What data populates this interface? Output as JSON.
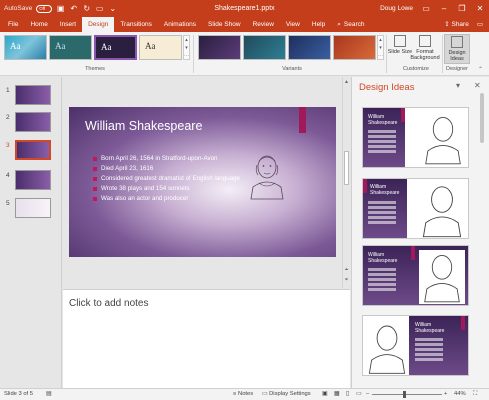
{
  "titlebar": {
    "autosave_label": "AutoSave",
    "autosave_state": "Off",
    "doc_title": "Shakespeare1.pptx",
    "user": "Doug Lowe",
    "qa_icons": [
      "save-icon",
      "undo-icon",
      "redo-icon",
      "present-icon",
      "customize-icon"
    ],
    "win_icons": [
      "ribbon-display-icon",
      "minimize-icon",
      "restore-icon",
      "close-icon"
    ]
  },
  "tabs": [
    {
      "label": "File"
    },
    {
      "label": "Home"
    },
    {
      "label": "Insert"
    },
    {
      "label": "Design"
    },
    {
      "label": "Transitions"
    },
    {
      "label": "Animations"
    },
    {
      "label": "Slide Show"
    },
    {
      "label": "Review"
    },
    {
      "label": "View"
    },
    {
      "label": "Help"
    }
  ],
  "search_label": "Search",
  "share_label": "Share",
  "ribbon": {
    "themes_label": "Themes",
    "variants_label": "Variants",
    "customize_label": "Customize",
    "designer_label": "Designer",
    "slide_size": "Slide Size",
    "format_background": "Format Background",
    "design_ideas": "Design Ideas",
    "theme_text": "Aa"
  },
  "slides": [
    {
      "num": "1"
    },
    {
      "num": "2"
    },
    {
      "num": "3"
    },
    {
      "num": "4"
    },
    {
      "num": "5"
    }
  ],
  "slide": {
    "title": "William Shakespeare",
    "bullets": [
      "Born April 26, 1564 in Stratford-upon-Avon",
      "Died April 23, 1616",
      "Considered greatest dramatist of English language",
      "Wrote 38 plays and 154 sonnets",
      "Was also an actor and producer"
    ]
  },
  "notes_placeholder": "Click to add notes",
  "design_ideas": {
    "title": "Design Ideas",
    "idea_title_1": "William Shakespeare",
    "idea_title_2": "William Shakespeare",
    "idea_title_3": "William Shakespeare",
    "idea_title_4": "William Shakespeare"
  },
  "status": {
    "slide_info": "Slide 3 of 5",
    "notes": "Notes",
    "display_settings": "Display Settings",
    "zoom": "44%"
  },
  "colors": {
    "accent": "#c43e1c",
    "highlight": "#d24726",
    "slide_bar": "#a2195b"
  }
}
